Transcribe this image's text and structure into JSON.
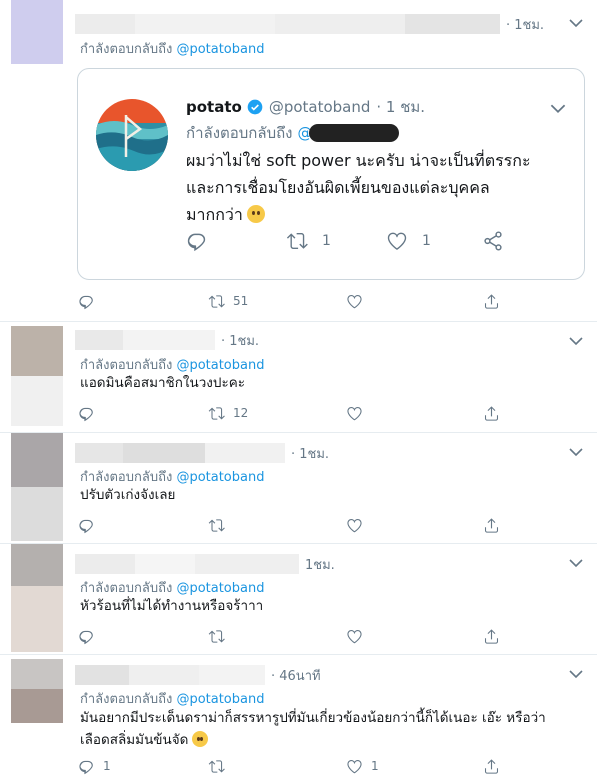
{
  "colors": {
    "link": "#1b95e0",
    "muted": "#657786",
    "text": "#14171a",
    "border": "#e6ecf0",
    "verified": "#1da1f2"
  },
  "tweets": [
    {
      "time": "· 1ชม.",
      "reply_prefix": "กำลังตอบกลับถึง",
      "reply_handle": "@potatoband",
      "body": "",
      "counts": {
        "reply": "",
        "retweet": "51",
        "like": "",
        "share": ""
      }
    },
    {
      "time": "· 1ชม.",
      "reply_prefix": "กำลังตอบกลับถึง",
      "reply_handle": "@potatoband",
      "body": "แอดมินคือสมาชิกในวงปะคะ",
      "counts": {
        "reply": "",
        "retweet": "12",
        "like": "",
        "share": ""
      }
    },
    {
      "time": "· 1ชม.",
      "reply_prefix": "กำลังตอบกลับถึง",
      "reply_handle": "@potatoband",
      "body": "ปรับตัวเก่งจังเลย",
      "counts": {
        "reply": "",
        "retweet": "",
        "like": "",
        "share": ""
      }
    },
    {
      "time": "1ชม.",
      "reply_prefix": "กำลังตอบกลับถึง",
      "reply_handle": "@potatoband",
      "body": "หัวร้อนที่ไม่ได้ทำงานหรือจร้าาา",
      "counts": {
        "reply": "",
        "retweet": "",
        "like": "",
        "share": ""
      }
    },
    {
      "time": "· 46นาที",
      "reply_prefix": "กำลังตอบกลับถึง",
      "reply_handle": "@potatoband",
      "body_lines": [
        "มันอยากมีประเด็นดราม่าก็สรรหารูปที่มันเกี่ยวข้องน้อยกว่านี้ก็ได้เนอะ เอ๊ะ หรือว่า",
        "เลือดสลิ่มมันข้นจัด"
      ],
      "counts": {
        "reply": "1",
        "retweet": "",
        "like": "1",
        "share": ""
      }
    }
  ],
  "quoted": {
    "name": "potato",
    "handle": "@potatoband",
    "time": "· 1 ชม.",
    "reply_prefix": "กำลังตอบกลับถึง",
    "reply_handle": "@",
    "text_lines": [
      "ผมว่าไม่ใช่ soft power นะครับ น่าจะเป็นที่ตรรกะ",
      "และการเชื่อมโยงอันผิดเพี้ยนของแต่ละบุคคล",
      "มากกว่า"
    ],
    "counts": {
      "reply": "",
      "retweet": "1",
      "like": "1",
      "share": ""
    }
  },
  "icons": [
    "reply-icon",
    "retweet-icon",
    "like-icon",
    "share-icon",
    "chevron-down-icon",
    "verified-icon",
    "emoji-icon"
  ]
}
